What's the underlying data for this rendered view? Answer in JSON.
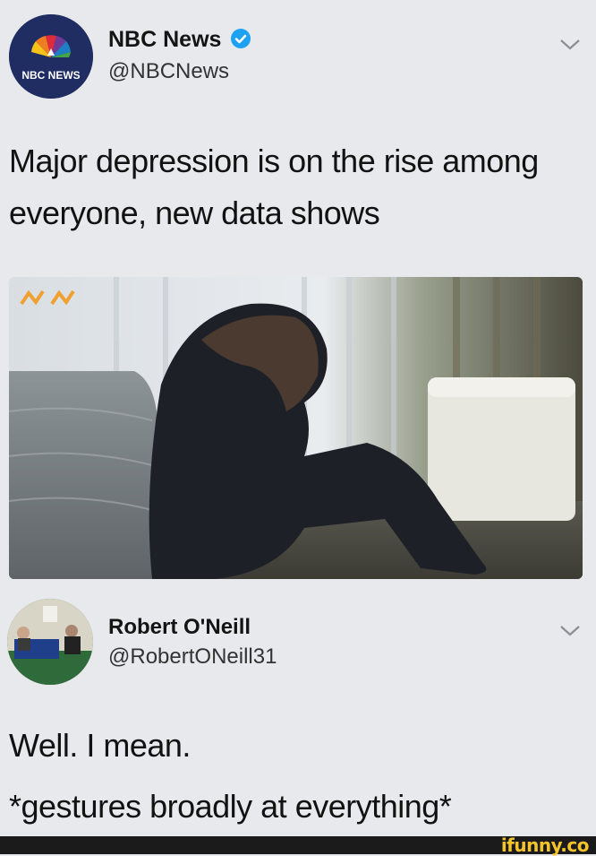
{
  "tweet1": {
    "display_name": "NBC News",
    "handle": "@NBCNews",
    "avatar_label": "NBC NEWS",
    "verified": true,
    "text_line1": "Major depression is on the rise among",
    "text_line2": "everyone, new data shows"
  },
  "tweet2": {
    "display_name": "Robert O'Neill",
    "handle": "@RobertONeill31",
    "text_line1": "Well. I mean.",
    "text_line2": "*gestures broadly at everything*"
  },
  "watermark": "ifunny.co",
  "colors": {
    "background": "#e7e9ec",
    "verified_blue": "#1da1f2",
    "watermark_yellow": "#f4c52b"
  }
}
